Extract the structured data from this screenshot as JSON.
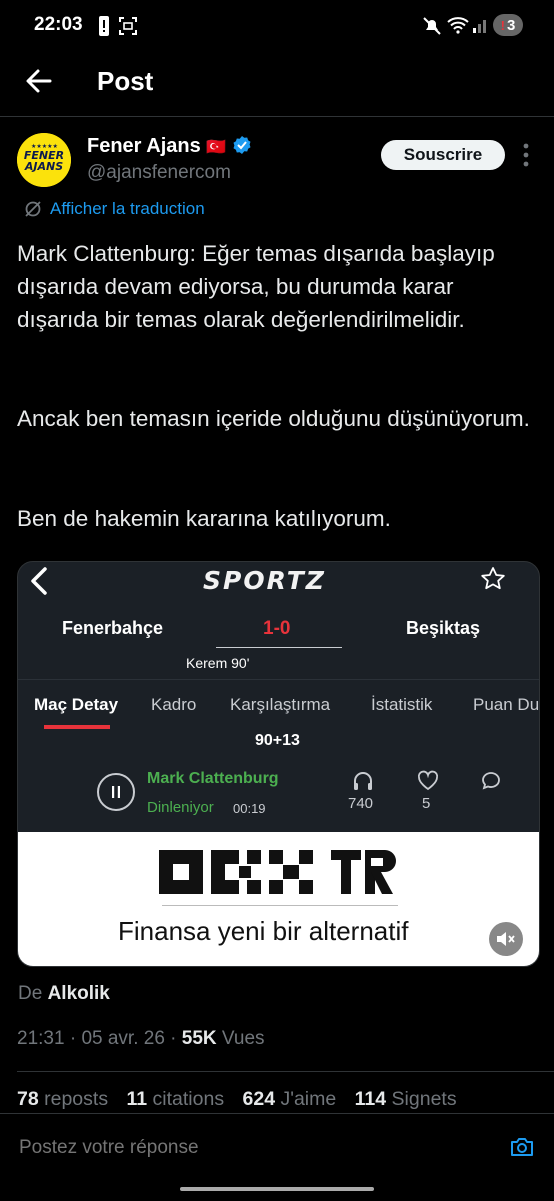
{
  "status_bar": {
    "time": "22:03",
    "notification_badge": "3"
  },
  "header": {
    "title": "Post"
  },
  "author": {
    "name": "Fener Ajans",
    "flag": "🇹🇷",
    "handle": "@ajansfenercom",
    "avatar_text_1": "FENER",
    "avatar_text_2": "AJANS",
    "subscribe_label": "Souscrire",
    "verified_color": "#1d9bf0"
  },
  "translate_label": "Afficher la traduction",
  "tweet": {
    "paragraphs": [
      "Mark Clattenburg: Eğer temas dışarıda başlayıp dışarıda devam ediyorsa, bu durumda karar dışarıda bir temas olarak değerlendirilmelidir.",
      "Ancak ben temasın içeride olduğunu düşünüyorum.",
      "Ben de hakemin kararına katılıyorum."
    ]
  },
  "media": {
    "logo": "SPORTZ",
    "home_team": "Fenerbahçe",
    "away_team": "Beşiktaş",
    "score": "1-0",
    "scorer": "Kerem 90'",
    "tabs": [
      "Maç Detay",
      "Kadro",
      "Karşılaştırma",
      "İstatistik",
      "Puan Du"
    ],
    "active_tab": "Maç Detay",
    "minute": "90+13",
    "speaker": "Mark Clattenburg",
    "listening_label": "Dinleniyor",
    "listening_time": "00:19",
    "listeners": "740",
    "likes": "5",
    "accent_color": "#e8333b",
    "ad_brand": "OKX TR",
    "ad_tagline": "Finansa yeni bir alternatif"
  },
  "source": {
    "prefix": "De",
    "name": "Alkolik"
  },
  "meta": {
    "time": "21:31",
    "date": "05 avr. 26",
    "views_count": "55K",
    "views_label": "Vues"
  },
  "stats": {
    "reposts_count": "78",
    "reposts_label": "reposts",
    "citations_count": "11",
    "citations_label": "citations",
    "likes_count": "624",
    "likes_label": "J'aime",
    "bookmarks_count": "114",
    "bookmarks_label": "Signets"
  },
  "reply": {
    "placeholder": "Postez votre réponse"
  }
}
